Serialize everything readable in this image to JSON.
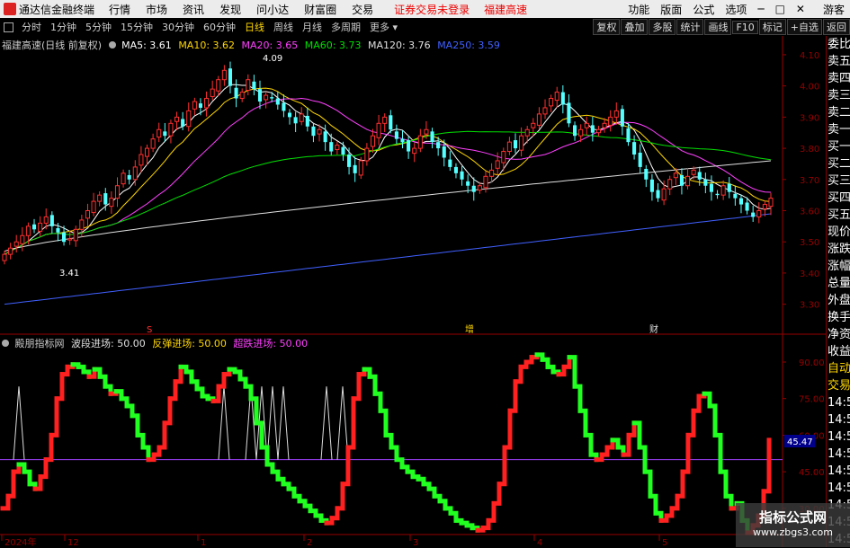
{
  "menu": {
    "app_title": "通达信金融终端",
    "items": [
      "行情",
      "市场",
      "资讯",
      "发现",
      "问小达",
      "财富圈",
      "交易"
    ],
    "notice_login": "证券交易未登录",
    "notice_stock": "福建高速",
    "right_items": [
      "功能",
      "版面",
      "公式",
      "选项"
    ],
    "guest": "游客"
  },
  "toolbar": {
    "periods": [
      "分时",
      "1分钟",
      "5分钟",
      "15分钟",
      "30分钟",
      "60分钟",
      "日线",
      "周线",
      "月线",
      "多周期",
      "更多"
    ],
    "active_period": "日线",
    "right_buttons": [
      "复权",
      "叠加",
      "多股",
      "统计",
      "画线",
      "F10",
      "标记",
      "+自选",
      "返回"
    ]
  },
  "main_chart": {
    "title": "福建高速(日线 前复权)",
    "ma_labels": [
      {
        "text": "MA5: 3.61",
        "color": "#ffffff"
      },
      {
        "text": "MA10: 3.62",
        "color": "#ffd700"
      },
      {
        "text": "MA20: 3.65",
        "color": "#ff40ff"
      },
      {
        "text": "MA60: 3.73",
        "color": "#00e000"
      },
      {
        "text": "MA120: 3.76",
        "color": "#e0e0e0"
      },
      {
        "text": "MA250: 3.59",
        "color": "#4060ff"
      }
    ],
    "high_label": "4.09",
    "low_label": "3.41",
    "event_marks": [
      "S",
      "增",
      "财"
    ]
  },
  "sub_chart": {
    "title": "殿朋指标网",
    "labels": [
      {
        "text": "波段进场: 50.00",
        "color": "#e0e0e0"
      },
      {
        "text": "反弹进场: 50.00",
        "color": "#ffd700"
      },
      {
        "text": "超跌进场: 50.00",
        "color": "#ff40ff"
      }
    ],
    "current_value": "45.47"
  },
  "date_axis": {
    "labels": [
      "2024年",
      "12",
      "1",
      "2",
      "3",
      "4",
      "5"
    ]
  },
  "right_panel": {
    "items": [
      "委比",
      "卖五",
      "卖四",
      "卖三",
      "卖二",
      "卖一",
      "买一",
      "买二",
      "买三",
      "买四",
      "买五",
      "现价",
      "涨跌",
      "涨幅",
      "总量",
      "外盘",
      "换手",
      "净资",
      "收益",
      "自动",
      "交易",
      "14:56",
      "14:56",
      "14:56",
      "14:56",
      "14:56",
      "14:56",
      "14:56",
      "14:56",
      "14:56"
    ]
  },
  "watermark": {
    "line1": "指标公式网",
    "line2": "www.zbgs3.com"
  },
  "chart_data": [
    {
      "type": "candlestick",
      "title": "福建高速(日线 前复权)",
      "ylim": [
        3.25,
        4.12
      ],
      "y_ticks": [
        3.3,
        3.4,
        3.5,
        3.6,
        3.7,
        3.8,
        3.9,
        4.0,
        4.1
      ],
      "n_bars": 130,
      "close": [
        3.46,
        3.48,
        3.5,
        3.52,
        3.55,
        3.54,
        3.56,
        3.58,
        3.55,
        3.53,
        3.5,
        3.51,
        3.54,
        3.57,
        3.6,
        3.63,
        3.65,
        3.62,
        3.64,
        3.68,
        3.72,
        3.7,
        3.74,
        3.78,
        3.8,
        3.83,
        3.86,
        3.84,
        3.88,
        3.9,
        3.87,
        3.92,
        3.95,
        3.93,
        3.96,
        3.99,
        4.02,
        4.05,
        4.0,
        3.96,
        3.98,
        4.02,
        3.99,
        3.95,
        3.97,
        3.96,
        3.94,
        3.92,
        3.9,
        3.88,
        3.91,
        3.87,
        3.84,
        3.86,
        3.82,
        3.79,
        3.81,
        3.78,
        3.74,
        3.72,
        3.76,
        3.8,
        3.84,
        3.88,
        3.9,
        3.86,
        3.83,
        3.82,
        3.79,
        3.8,
        3.84,
        3.86,
        3.82,
        3.8,
        3.77,
        3.74,
        3.72,
        3.7,
        3.68,
        3.66,
        3.68,
        3.71,
        3.73,
        3.76,
        3.79,
        3.82,
        3.8,
        3.84,
        3.86,
        3.88,
        3.91,
        3.93,
        3.96,
        3.98,
        3.94,
        3.88,
        3.84,
        3.86,
        3.88,
        3.85,
        3.86,
        3.88,
        3.9,
        3.92,
        3.87,
        3.82,
        3.78,
        3.74,
        3.7,
        3.66,
        3.64,
        3.67,
        3.7,
        3.72,
        3.68,
        3.71,
        3.73,
        3.7,
        3.68,
        3.66,
        3.65,
        3.68,
        3.66,
        3.64,
        3.62,
        3.6,
        3.58,
        3.6,
        3.62,
        3.64
      ],
      "series": [
        {
          "name": "MA5",
          "value": 3.61
        },
        {
          "name": "MA10",
          "value": 3.62
        },
        {
          "name": "MA20",
          "value": 3.65
        },
        {
          "name": "MA60",
          "value": 3.73
        },
        {
          "name": "MA120",
          "value": 3.76
        },
        {
          "name": "MA250",
          "value": 3.59
        }
      ],
      "annotations": [
        {
          "text": "4.09",
          "value": 4.09
        },
        {
          "text": "3.41",
          "value": 3.41
        }
      ],
      "grid": false
    },
    {
      "type": "line",
      "title": "殿朋指标网",
      "ylim": [
        20,
        97
      ],
      "y_ticks": [
        30,
        45,
        60,
        75,
        90
      ],
      "threshold": 50,
      "values": [
        30,
        35,
        45,
        48,
        45,
        40,
        38,
        43,
        50,
        60,
        75,
        85,
        88,
        89,
        88,
        86,
        84,
        87,
        84,
        80,
        77,
        78,
        75,
        72,
        68,
        60,
        55,
        50,
        52,
        55,
        65,
        75,
        82,
        88,
        86,
        82,
        79,
        76,
        75,
        74,
        80,
        85,
        87,
        86,
        83,
        80,
        75,
        65,
        55,
        48,
        45,
        42,
        40,
        38,
        35,
        33,
        31,
        29,
        27,
        25,
        24,
        26,
        30,
        40,
        55,
        75,
        85,
        87,
        84,
        77,
        70,
        60,
        55,
        50,
        47,
        45,
        43,
        42,
        40,
        38,
        35,
        33,
        30,
        28,
        25,
        24,
        23,
        22,
        21,
        22,
        25,
        32,
        40,
        55,
        70,
        82,
        88,
        90,
        92,
        93,
        91,
        88,
        86,
        85,
        88,
        92,
        80,
        70,
        60,
        52,
        50,
        52,
        55,
        58,
        55,
        52,
        60,
        65,
        55,
        45,
        35,
        28,
        25,
        27,
        30,
        35,
        45,
        60,
        70,
        76,
        77,
        72,
        60,
        45,
        35,
        30,
        32,
        25,
        20,
        23,
        27,
        37,
        58
      ],
      "spike_marks": [
        3,
        41,
        46,
        48,
        50,
        52,
        60,
        63
      ],
      "grid": false
    }
  ]
}
